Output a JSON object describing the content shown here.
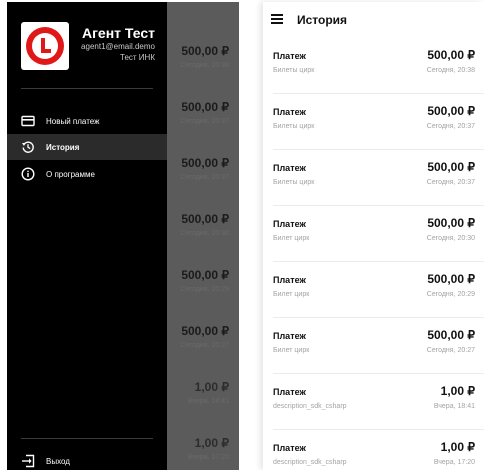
{
  "drawer": {
    "user_name": "Агент Тест",
    "user_email": "agent1@email.demo",
    "user_company": "Тест ИНК",
    "menu": [
      {
        "icon": "card-icon",
        "label": "Новый платеж"
      },
      {
        "icon": "history-icon",
        "label": "История"
      },
      {
        "icon": "info-icon",
        "label": "О программе"
      }
    ],
    "logout_label": "Выход"
  },
  "history": {
    "title": "История",
    "items": [
      {
        "title": "Платеж",
        "description": "Билеты цирк",
        "amount": "500,00 ₽",
        "date": "Сегодня, 20:38"
      },
      {
        "title": "Платеж",
        "description": "Билеты цирк",
        "amount": "500,00 ₽",
        "date": "Сегодня, 20:37"
      },
      {
        "title": "Платеж",
        "description": "Билеты цирк",
        "amount": "500,00 ₽",
        "date": "Сегодня, 20:37"
      },
      {
        "title": "Платеж",
        "description": "Билет цирк",
        "amount": "500,00 ₽",
        "date": "Сегодня, 20:30"
      },
      {
        "title": "Платеж",
        "description": "Билет цирк",
        "amount": "500,00 ₽",
        "date": "Сегодня, 20:29"
      },
      {
        "title": "Платеж",
        "description": "Билет цирк",
        "amount": "500,00 ₽",
        "date": "Сегодня, 20:27"
      },
      {
        "title": "Платеж",
        "description": "description_sdk_csharp",
        "amount": "1,00 ₽",
        "date": "Вчера, 18:41"
      },
      {
        "title": "Платеж",
        "description": "description_sdk_csharp",
        "amount": "1,00 ₽",
        "date": "Вчера, 17:20"
      }
    ]
  },
  "colors": {
    "drawer_bg": "#000000",
    "active_item_bg": "#2b2b2b",
    "scrim": "#5b5b5b",
    "logo_red": "#e01818"
  }
}
